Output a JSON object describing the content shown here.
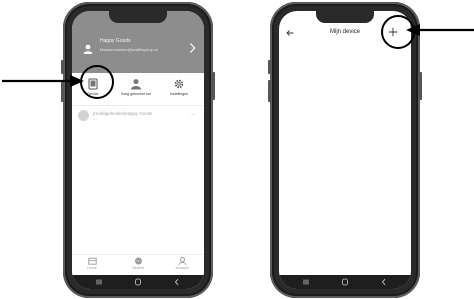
{
  "left_phone": {
    "profile": {
      "name": "Happy Goods",
      "email": "Maartenvanrice@seattlegroup.nl"
    },
    "quick_actions": [
      {
        "label": "Device",
        "icon": "device-icon"
      },
      {
        "label": "Voeg gebruiker toe",
        "icon": "user-add-icon"
      },
      {
        "label": "Instellingen",
        "icon": "gear-icon"
      }
    ],
    "device_entry": {
      "title": "[Hoofdgebruiker]Happy Goods",
      "subtitle": "...",
      "more": "..."
    },
    "bottom_tabs": [
      {
        "label": "Home",
        "icon": "home-icon"
      },
      {
        "label": "Bericht",
        "icon": "message-icon"
      },
      {
        "label": "Account",
        "icon": "account-icon"
      }
    ],
    "system_nav": [
      "recent-apps-icon",
      "home-button-icon",
      "back-icon"
    ]
  },
  "right_phone": {
    "title": "Mijn device",
    "back_icon": "back-arrow-icon",
    "add_icon": "plus-icon",
    "system_nav": [
      "recent-apps-icon",
      "home-button-icon",
      "back-icon"
    ]
  },
  "annotations": {
    "left_arrow_target": "Device",
    "right_arrow_target": "+"
  }
}
